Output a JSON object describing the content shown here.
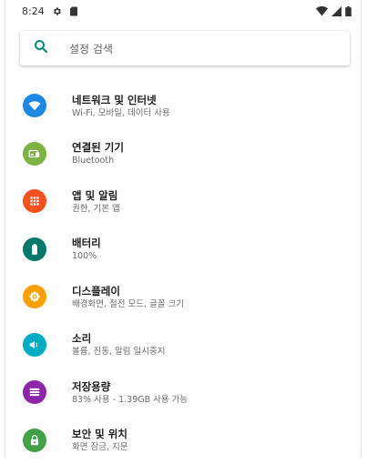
{
  "status_bar": {
    "time": "8:24",
    "left_icons": [
      "settings-icon",
      "sd-card-icon"
    ],
    "right_icons": [
      "wifi-icon",
      "signal-icon",
      "battery-icon"
    ]
  },
  "search": {
    "placeholder": "설정 검색",
    "icon": "search-icon",
    "icon_color": "#00897b"
  },
  "items": [
    {
      "title": "네트워크 및 인터넷",
      "subtitle": "Wi-Fi, 모바일, 데이터 사용",
      "icon": "wifi-icon",
      "color": "#1e88e5"
    },
    {
      "title": "연결된 기기",
      "subtitle": "Bluetooth",
      "icon": "devices-icon",
      "color": "#7cb342"
    },
    {
      "title": "앱 및 알림",
      "subtitle": "권한, 기본 앱",
      "icon": "apps-icon",
      "color": "#f4511e"
    },
    {
      "title": "배터리",
      "subtitle": "100%",
      "icon": "battery-icon",
      "color": "#00796b"
    },
    {
      "title": "디스플레이",
      "subtitle": "배경화면, 절전 모드, 글꼴 크기",
      "icon": "brightness-icon",
      "color": "#ffa000"
    },
    {
      "title": "소리",
      "subtitle": "볼륨, 진동, 알림 일시중지",
      "icon": "volume-icon",
      "color": "#00acc1"
    },
    {
      "title": "저장용량",
      "subtitle": "83% 사용 - 1.39GB 사용 가능",
      "icon": "storage-icon",
      "color": "#8e24aa"
    },
    {
      "title": "보안 및 위치",
      "subtitle": "화면 잠금, 지문",
      "icon": "lock-icon",
      "color": "#43a047"
    }
  ]
}
